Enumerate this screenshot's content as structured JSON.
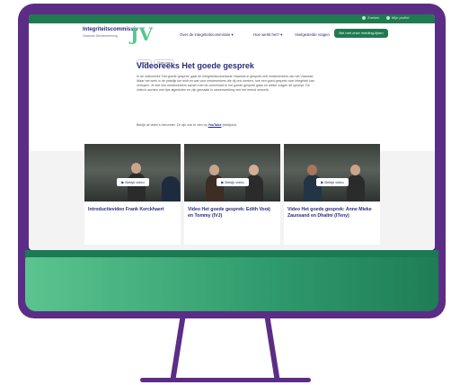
{
  "site": {
    "topbar": {
      "links": [
        "Zoeken",
        "Mijn profiel"
      ]
    },
    "logo": {
      "name": "Integriteitscommissie",
      "subtitle": "Vlaamse Dienstverlening",
      "mark": "JV"
    },
    "nav": [
      "Over de integriteitscommissie",
      "Hoe werkt het?",
      "Veelgestelde vragen"
    ],
    "cta": "Bel met onze melding-lijnen"
  },
  "breadcrumb": [
    "Home",
    "Over ons"
  ],
  "page": {
    "title": "Videoreeks Het goede gesprek",
    "intro": "In de videoreeks 'Het goede gesprek' gaat de Integriteitscommissie Vlaamse in gesprek met medewerkers van het Vlaamse. Waar het werk in de praktijk toe leidt en wat voor medewerkers die bij ons werken, hoe een goed gesprek over integriteit kan verlopen. Je ziet hoe medewerkers samen met de commissie in het goede gesprek gaan en welke vragen dit oproept. De video's worden met tips afgesloten en zijn gemaakt in samenwerking met het lerend netwerk.",
    "more": "Bekijk de video's hieronder. Ze zijn ook te zien op",
    "link": "YouTube",
    "more_end": "(bekijken)."
  },
  "cards": [
    {
      "play": "Bekijk video",
      "title": "Introductievideo Frank Kerckhaert"
    },
    {
      "play": "Bekijk video",
      "title": "Video Het goede gesprek: Edith Vooij en Tommy (IVJ)"
    },
    {
      "play": "Bekijk video",
      "title": "Video Het goede gesprek: Anne Mieke Zaunsand en Dhalini (ITeny)"
    }
  ],
  "colors": {
    "frame": "#5b2d86",
    "brand": "#2a2d7c",
    "accent": "#1f7a4f",
    "green": "#5bc48f"
  }
}
